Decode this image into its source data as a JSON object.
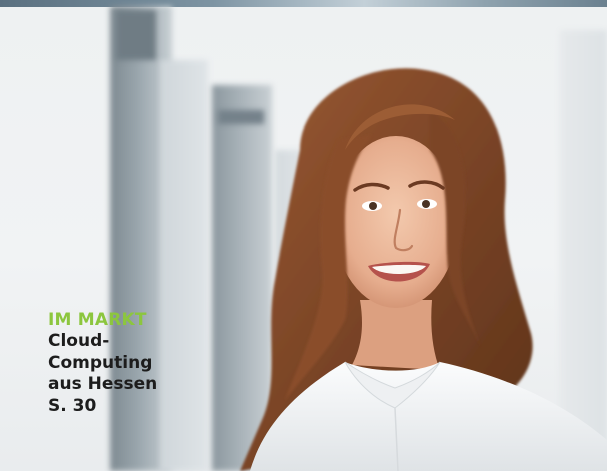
{
  "article": {
    "section": "IM MARKT",
    "headline": "Cloud-\nComputing\naus Hessen",
    "page_ref": "S. 30"
  },
  "colors": {
    "kicker": "#8cc63e",
    "text": "#1d1d1d",
    "background": "#eef1f2"
  },
  "image": {
    "subject": "portrait-photo"
  }
}
